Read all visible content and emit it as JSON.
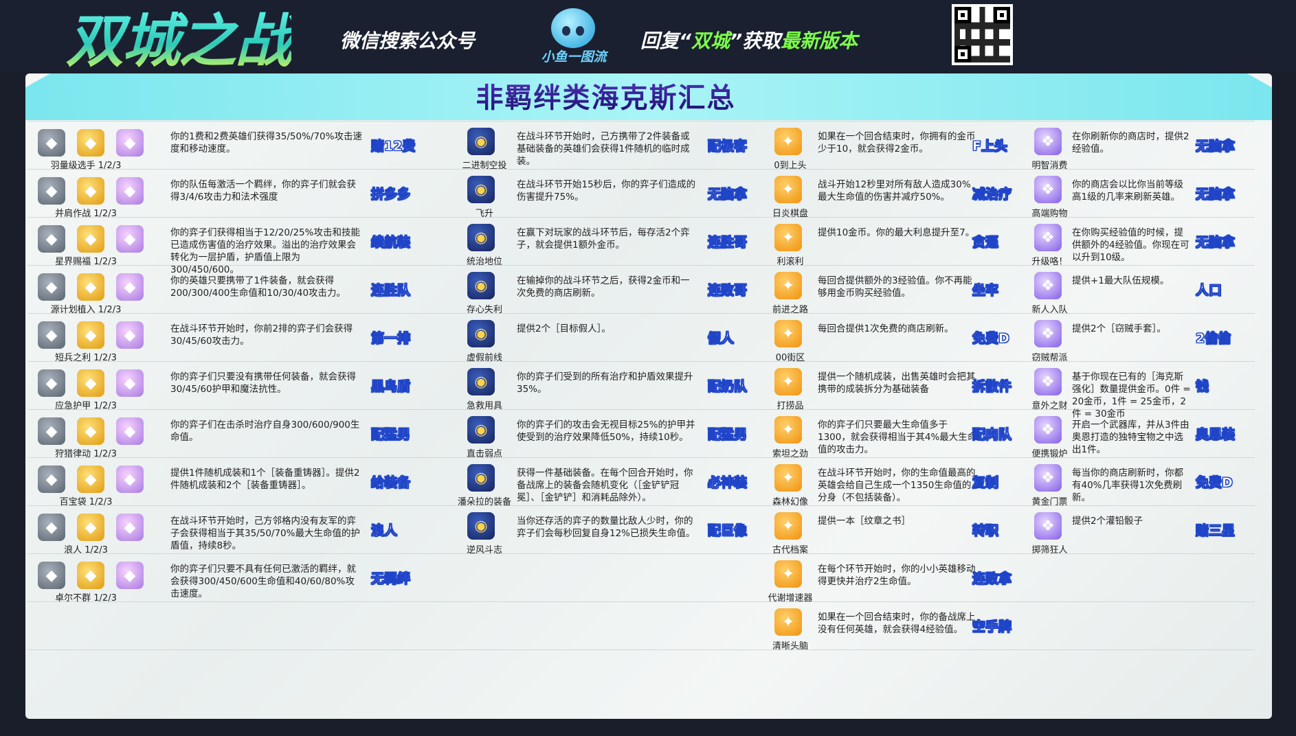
{
  "header": {
    "logo": "双城之战",
    "wechat_search": "微信搜索公众号",
    "mascot_caption": "小鱼一图流",
    "reply_prefix": "回复“",
    "reply_keyword": "双城",
    "reply_mid": "”获取",
    "reply_suffix": "最新版本"
  },
  "title": "非羁绊类海克斯汇总",
  "col1": [
    {
      "name": "羽量级选手 1/2/3",
      "desc": "你的1费和2费英雄们获得35/50%/70%攻击速度和移动速度。",
      "tag": "赌12费"
    },
    {
      "name": "并肩作战 1/2/3",
      "desc": "你的队伍每激活一个羁绊，你的弈子们就会获得3/4/6攻击力和法术强度",
      "tag": "拼多多"
    },
    {
      "name": "星界赐福 1/2/3",
      "desc": "你的弈子们获得相当于12/20/25%攻击和技能已造成伤害值的治疗效果。溢出的治疗效果会转化为一层护盾，护盾值上限为300/450/600。",
      "tag": "续航装"
    },
    {
      "name": "源计划植入 1/2/3",
      "desc": "你的英雄只要携带了1件装备，就会获得200/300/400生命值和10/30/40攻击力。",
      "tag": "连胜队"
    },
    {
      "name": "短兵之利 1/2/3",
      "desc": "在战斗环节开始时，你前2排的弈子们会获得30/45/60攻击力。",
      "tag": "第一排"
    },
    {
      "name": "应急护甲 1/2/3",
      "desc": "你的弈子们只要没有携带任何装备，就会获得30/45/60护甲和魔法抗性。",
      "tag": "黑鸟盾"
    },
    {
      "name": "狩猎律动 1/2/3",
      "desc": "你的弈子们在击杀时治疗自身300/600/900生命值。",
      "tag": "配猛男"
    },
    {
      "name": "百宝袋 1/2/3",
      "desc": "提供1件随机成装和1个［装备重铸器］。提供2件随机成装和2个［装备重铸器］。",
      "tag": "给装备"
    },
    {
      "name": "浪人 1/2/3",
      "desc": "在战斗环节开始时，己方邻格内没有友军的弈子会获得相当于其35/50/70%最大生命值的护盾值，持续8秒。",
      "tag": "浪人"
    },
    {
      "name": "卓尔不群 1/2/3",
      "desc": "你的弈子们只要不具有任何已激活的羁绊，就会获得300/450/600生命值和40/60/80%攻击速度。",
      "tag": "无羁绊"
    }
  ],
  "col2": [
    {
      "name": "二进制空投",
      "desc": "在战斗环节开始时，己方携带了2件装备或基础装备的英雄们会获得1件随机的临时成装。",
      "tag": "配极客"
    },
    {
      "name": "飞升",
      "desc": "在战斗环节开始15秒后，你的弈子们造成的伤害提升75%。",
      "tag": "无脑拿"
    },
    {
      "name": "统治地位",
      "desc": "在赢下对玩家的战斗环节后，每存活2个弈子，就会提供1额外金币。",
      "tag": "连胜哥"
    },
    {
      "name": "存心失利",
      "desc": "在输掉你的战斗环节之后，获得2金币和一次免费的商店刷新。",
      "tag": "连败哥"
    },
    {
      "name": "虚假前线",
      "desc": "提供2个［目标假人］。",
      "tag": "假人"
    },
    {
      "name": "急救用具",
      "desc": "你的弈子们受到的所有治疗和护盾效果提升35%。",
      "tag": "配奶队"
    },
    {
      "name": "直击弱点",
      "desc": "你的弈子们的攻击会无视目标25%的护甲并使受到的治疗效果降低50%，持续10秒。",
      "tag": "配猛男"
    },
    {
      "name": "潘朵拉的装备",
      "desc": "获得一件基础装备。在每个回合开始时，你备战席上的装备会随机变化（［金铲铲冠冕］、［金铲铲］和消耗品除外）。",
      "tag": "必神装"
    },
    {
      "name": "逆风斗志",
      "desc": "当你还存活的弈子的数量比敌人少时，你的弈子们会每秒回复自身12%已损失生命值。",
      "tag": "配巨像"
    }
  ],
  "col3": [
    {
      "name": "0到上头",
      "desc": "如果在一个回合结束时，你拥有的金币少于10，就会获得2金币。",
      "tag": "F上头"
    },
    {
      "name": "日炎棋盘",
      "desc": "战斗开始12秒里对所有敌人造成30%最大生命值的伤害并减疗50%。",
      "tag": "减治疗"
    },
    {
      "name": "利滚利",
      "desc": "提供10金币。你的最大利息提升至7。",
      "tag": "贪逼"
    },
    {
      "name": "前进之路",
      "desc": "每回合提供额外的3经验值。你不再能够用金币购买经验值。",
      "tag": "坐牢"
    },
    {
      "name": "00街区",
      "desc": "每回合提供1次免费的商店刷新。",
      "tag": "免费D"
    },
    {
      "name": "打捞品",
      "desc": "提供一个随机成装，出售英雄时会把其携带的成装拆分为基础装备",
      "tag": "拆散件"
    },
    {
      "name": "索坦之劲",
      "desc": "你的弈子们只要最大生命值多于1300，就会获得相当于其4%最大生命值的攻击力。",
      "tag": "配肉队"
    },
    {
      "name": "森林幻像",
      "desc": "在战斗环节开始时，你的生命值最高的英雄会给自己生成一个1350生命值的分身（不包括装备）。",
      "tag": "复制"
    },
    {
      "name": "古代档案",
      "desc": "提供一本［纹章之书］",
      "tag": "转职"
    },
    {
      "name": "代谢增速器",
      "desc": "在每个环节开始时，你的小小英雄移动得更快并治疗2生命值。",
      "tag": "连败拿"
    },
    {
      "name": "清晰头脑",
      "desc": "如果在一个回合结束时，你的备战席上没有任何英雄，就会获得4经验值。",
      "tag": "空手牌"
    }
  ],
  "col4": [
    {
      "name": "明智消费",
      "desc": "在你刷新你的商店时，提供2经验值。",
      "tag": "无脑拿"
    },
    {
      "name": "高端购物",
      "desc": "你的商店会以比你当前等级高1级的几率来刷新英雄。",
      "tag": "无脑拿"
    },
    {
      "name": "升级咯！",
      "desc": "在你购买经验值的时候，提供额外的4经验值。你现在可以升到10级。",
      "tag": "无脑拿"
    },
    {
      "name": "新人入队",
      "desc": "提供+1最大队伍规模。",
      "tag": "人口"
    },
    {
      "name": "窃贼帮派",
      "desc": "提供2个［窃贼手套］。",
      "tag": "2偷偷"
    },
    {
      "name": "意外之财",
      "desc": "基于你现在已有的［海克斯强化］数量提供金币。0件 = 20金币，1件 = 25金币，2件 = 30金币",
      "tag": "钱"
    },
    {
      "name": "便携锻炉",
      "desc": "开启一个武器库，并从3件由奥恩打造的独特宝物之中选出1件。",
      "tag": "奥恩装"
    },
    {
      "name": "黄金门票",
      "desc": "每当你的商店刷新时，你都有40%几率获得1次免费刷新。",
      "tag": "免费D"
    },
    {
      "name": "掷筛狂人",
      "desc": "提供2个灌铅骰子",
      "tag": "赌三星"
    }
  ],
  "colors": {
    "tag_text": "#ffffff",
    "tag_outline": "#1f44c8",
    "banner": "#8eeef2",
    "title": "#2a1e7a"
  }
}
